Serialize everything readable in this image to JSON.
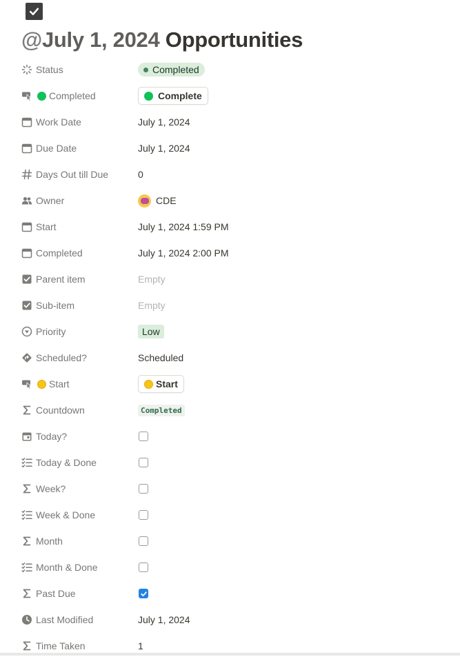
{
  "page": {
    "at_sign": "@",
    "date_text": "July 1, 2024",
    "title_text": "Opportunities"
  },
  "properties": [
    {
      "name": "Status",
      "icon": "status-icon",
      "type": "status",
      "value": "Completed",
      "color": "#448361"
    },
    {
      "name": "Completed",
      "icon": "button-cursor-icon",
      "type": "button",
      "value": "Complete",
      "emoji": "green-circle"
    },
    {
      "name": "Work Date",
      "icon": "calendar-icon",
      "type": "text",
      "value": "July 1, 2024"
    },
    {
      "name": "Due Date",
      "icon": "calendar-icon",
      "type": "text",
      "value": "July 1, 2024"
    },
    {
      "name": "Days Out till Due",
      "icon": "hash-icon",
      "type": "text",
      "value": "0"
    },
    {
      "name": "Owner",
      "icon": "people-icon",
      "type": "person",
      "value": "CDE"
    },
    {
      "name": "Start",
      "icon": "calendar-icon",
      "type": "text",
      "value": "July 1, 2024 1:59 PM"
    },
    {
      "name": "Completed",
      "icon": "calendar-icon",
      "type": "text",
      "value": "July 1, 2024 2:00 PM"
    },
    {
      "name": "Parent item",
      "icon": "checkbox-icon",
      "type": "empty",
      "value": "Empty"
    },
    {
      "name": "Sub-item",
      "icon": "checkbox-icon",
      "type": "empty",
      "value": "Empty"
    },
    {
      "name": "Priority",
      "icon": "select-icon",
      "type": "tag",
      "value": "Low"
    },
    {
      "name": "Scheduled?",
      "icon": "diamond-arrow-icon",
      "type": "text",
      "value": "Scheduled"
    },
    {
      "name": "Start",
      "icon": "button-cursor-icon",
      "type": "button",
      "value": "Start",
      "emoji": "sun"
    },
    {
      "name": "Countdown",
      "icon": "sigma-icon",
      "type": "code",
      "value": "Completed"
    },
    {
      "name": "Today?",
      "icon": "calendar-day-icon",
      "type": "checkbox",
      "checked": false
    },
    {
      "name": "Today & Done",
      "icon": "checklist-icon",
      "type": "checkbox",
      "checked": false
    },
    {
      "name": "Week?",
      "icon": "sigma-icon",
      "type": "checkbox",
      "checked": false
    },
    {
      "name": "Week & Done",
      "icon": "checklist-icon",
      "type": "checkbox",
      "checked": false
    },
    {
      "name": "Month",
      "icon": "sigma-icon",
      "type": "checkbox",
      "checked": false
    },
    {
      "name": "Month & Done",
      "icon": "checklist-icon",
      "type": "checkbox",
      "checked": false
    },
    {
      "name": "Past Due",
      "icon": "sigma-icon",
      "type": "checkbox",
      "checked": true
    },
    {
      "name": "Last Modified",
      "icon": "clock-icon",
      "type": "text",
      "value": "July 1, 2024"
    },
    {
      "name": "Time Taken",
      "icon": "sigma-icon",
      "type": "text",
      "value": "1"
    }
  ]
}
